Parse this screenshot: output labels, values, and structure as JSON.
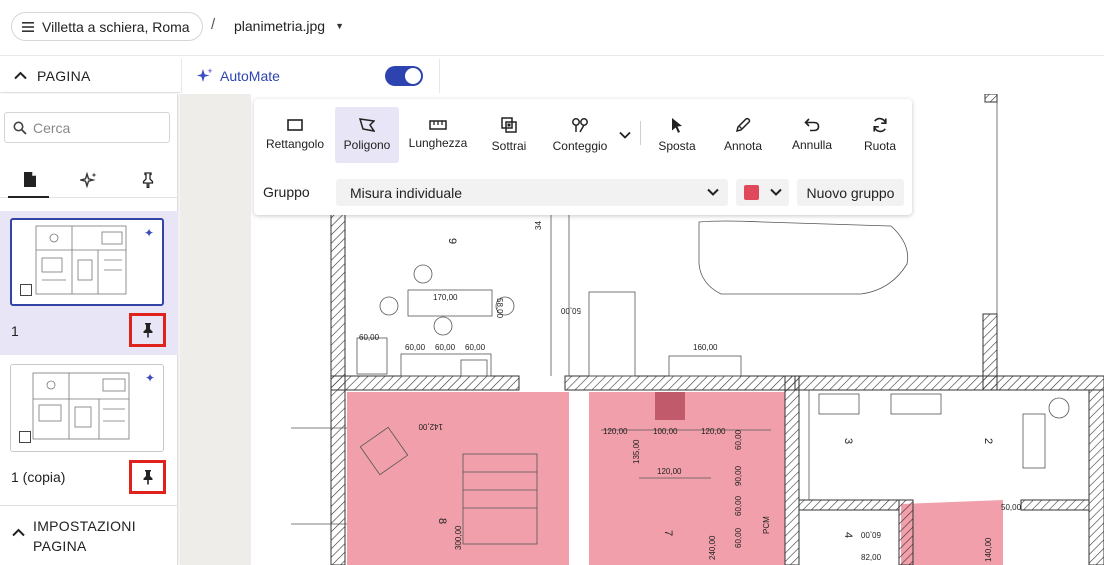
{
  "header": {
    "project_name": "Villetta a schiera, Roma",
    "separator": "/",
    "file_name": "planimetria.jpg"
  },
  "sidebar": {
    "section_title": "PAGINA",
    "search_placeholder": "Cerca",
    "tabs": [
      {
        "name": "pages",
        "icon": "document-icon"
      },
      {
        "name": "automate",
        "icon": "sparkle-icon"
      },
      {
        "name": "pinned",
        "icon": "pin-icon"
      }
    ],
    "pages": [
      {
        "label": "1",
        "selected": true
      },
      {
        "label": "1 (copia)",
        "selected": false
      }
    ],
    "settings_title": "IMPOSTAZIONI PAGINA"
  },
  "automate": {
    "label": "AutoMate",
    "enabled": true
  },
  "toolbar": {
    "tools": [
      {
        "label": "Rettangolo",
        "icon": "rectangle-icon"
      },
      {
        "label": "Poligono",
        "icon": "polygon-icon",
        "active": true
      },
      {
        "label": "Lunghezza",
        "icon": "ruler-icon"
      },
      {
        "label": "Sottrai",
        "icon": "subtract-icon"
      },
      {
        "label": "Conteggio",
        "icon": "count-icon"
      },
      {
        "label": "Sposta",
        "icon": "cursor-icon"
      },
      {
        "label": "Annota",
        "icon": "pencil-icon"
      },
      {
        "label": "Annulla",
        "icon": "undo-icon"
      },
      {
        "label": "Ruota",
        "icon": "rotate-icon"
      }
    ],
    "group_label": "Gruppo",
    "group_value": "Misura individuale",
    "color": "#e0495a",
    "new_group_label": "Nuovo gruppo"
  },
  "plan": {
    "room_numbers": [
      "9",
      "8",
      "7",
      "3",
      "2",
      "4"
    ],
    "dimensions": [
      "170,00",
      "58,00",
      "50,00",
      "60,00",
      "60,00",
      "60,00",
      "60,00",
      "160,00",
      "142,00",
      "120,00",
      "100,00",
      "120,00",
      "135,00",
      "120,00",
      "60,00",
      "90,00",
      "60,00",
      "60,00",
      "300,00",
      "240,00",
      "60,00",
      "82,00",
      "140,00",
      "50,00",
      "34"
    ],
    "labels": [
      "PCM"
    ],
    "highlight_color": "#ef8f9c"
  }
}
